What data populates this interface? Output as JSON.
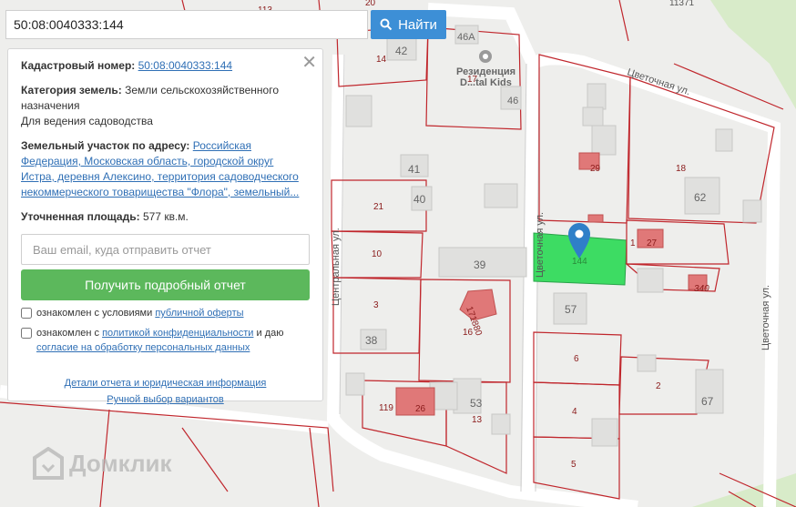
{
  "search": {
    "value": "50:08:0040333:144",
    "button_label": "Найти"
  },
  "panel": {
    "cadastral_label": "Кадастровый номер:",
    "cadastral_value": "50:08:0040333:144",
    "category_label": "Категория земель:",
    "category_value": "Земли сельскохозяйственного назначения",
    "usage": "Для ведения садоводства",
    "address_label": "Земельный участок по адресу:",
    "address_value": "Российская Федерация, Московская область, городской округ Истра, деревня Алексино, территория садоводческого некоммерческого товарищества \"Флора\", земельный...",
    "area_label": "Уточненная площадь:",
    "area_value": "577",
    "area_unit": "кв.м.",
    "email_placeholder": "Ваш email, куда отправить отчет",
    "report_button": "Получить подробный отчет",
    "consent1_text": "ознакомлен с условиями",
    "consent1_link": "публичной оферты",
    "consent2_text": "ознакомлен с",
    "consent2_link1": "политикой конфиденциальности",
    "consent2_mid": "и даю",
    "consent2_link2": "согласие на обработку персональных данных",
    "details_link": "Детали отчета и юридическая информация",
    "manual_link": "Ручной выбор вариантов"
  },
  "map": {
    "labels": {
      "n113": "113",
      "n20": "20",
      "n11371": "11371",
      "n42": "42",
      "n14": "14",
      "n46a": "46А",
      "residence_line1": "Резиденция",
      "residence_line2": "D...tal Kids",
      "n17": "17",
      "n46": "46",
      "street_top": "Цветочная ул.",
      "n29": "29",
      "n18": "18",
      "n41": "41",
      "n40": "40",
      "n62": "62",
      "n21": "21",
      "central_street": "Центральная ул.",
      "street_mid": "Цветочная ул.",
      "n144": "144",
      "n1": "1",
      "n27": "27",
      "n10": "10",
      "n39": "39",
      "n340": "340",
      "street_right": "Цветочная ул.",
      "n3": "3",
      "n171880": "171880",
      "n16": "16",
      "n57": "57",
      "n38": "38",
      "n6": "6",
      "n2": "2",
      "n119": "119",
      "n26": "26",
      "n53": "53",
      "n13": "13",
      "n4": "4",
      "n67": "67",
      "n5": "5"
    },
    "colors": {
      "selected_parcel": "#3ddc63",
      "boundary": "#c0262c",
      "marker": "#2f7fc8",
      "highlight_building": "#e07878"
    }
  },
  "watermark": "Домклик"
}
